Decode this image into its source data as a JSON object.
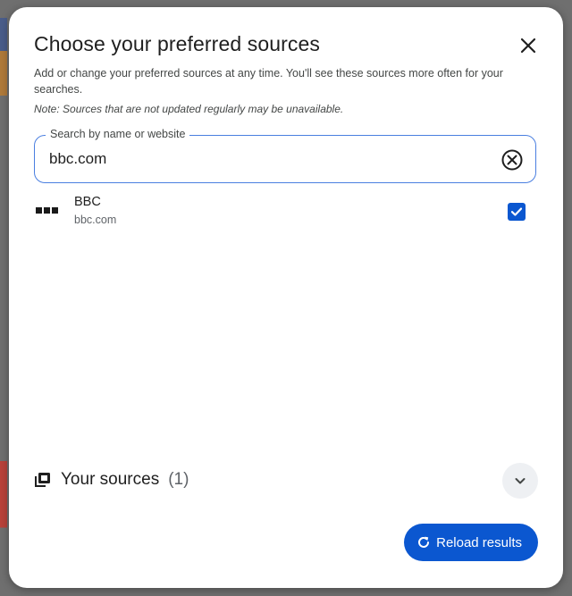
{
  "dialog": {
    "title": "Choose your preferred sources",
    "subtitle": "Add or change your preferred sources at any time. You'll see these sources more often for your searches.",
    "note": "Note: Sources that are not updated regularly may be unavailable.",
    "close_icon": "close-icon"
  },
  "search": {
    "label": "Search by name or website",
    "value": "bbc.com",
    "clear_icon": "clear-circle-icon"
  },
  "results": [
    {
      "name": "BBC",
      "domain": "bbc.com",
      "checked": true,
      "logo_icon": "bbc-logo-icon"
    }
  ],
  "your_sources": {
    "label": "Your sources",
    "count": "(1)",
    "icon": "library-icon",
    "expand_icon": "chevron-down-icon"
  },
  "reload": {
    "label": "Reload results",
    "icon": "refresh-icon"
  },
  "colors": {
    "accent": "#0b57d0",
    "search_border": "#4a7fe0"
  }
}
